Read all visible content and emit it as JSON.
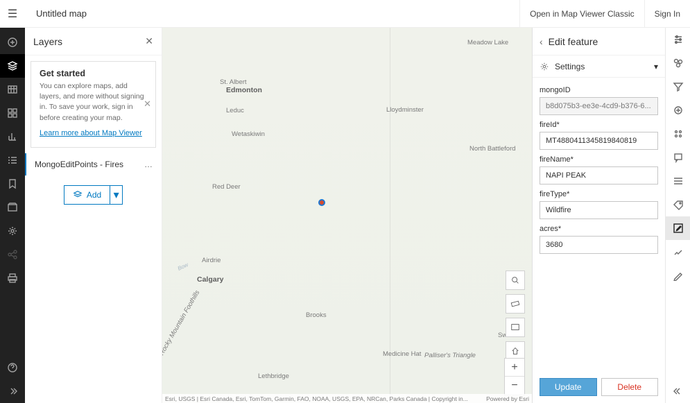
{
  "header": {
    "title": "Untitled map",
    "classic_link": "Open in Map Viewer Classic",
    "sign_in": "Sign In"
  },
  "panel": {
    "title": "Layers",
    "card": {
      "title": "Get started",
      "body": "You can explore maps, add layers, and more without signing in. To save your work, sign in before creating your map.",
      "link": "Learn more about Map Viewer"
    },
    "layer_name": "MongoEditPoints - Fires",
    "add_label": "Add"
  },
  "map": {
    "labels": {
      "meadow_lake": "Meadow Lake",
      "st_albert": "St. Albert",
      "edmonton": "Edmonton",
      "leduc": "Leduc",
      "wetaskiwin": "Wetaskiwin",
      "lloydminster": "Lloydminster",
      "north_battleford": "North Battleford",
      "red_deer": "Red Deer",
      "airdrie": "Airdrie",
      "calgary": "Calgary",
      "brooks": "Brooks",
      "medicine_hat": "Medicine Hat",
      "lethbridge": "Lethbridge",
      "swi": "Swi",
      "palliser": "Palliser's Triangle",
      "foothills": "Rocky Mountain Foothills",
      "bow": "Bow"
    },
    "attrib_left": "Esri, USGS | Esri Canada, Esri, TomTom, Garmin, FAO, NOAA, USGS, EPA, NRCan, Parks Canada | Copyright in...",
    "attrib_right": "Powered by Esri"
  },
  "edit": {
    "title": "Edit feature",
    "settings": "Settings",
    "fields": {
      "mongoID_label": "mongoID",
      "mongoID_value": "b8d075b3-ee3e-4cd9-b376-6...",
      "fireId_label": "fireId*",
      "fireId_value": "MT4880411345819840819",
      "fireName_label": "fireName*",
      "fireName_value": "NAPI PEAK",
      "fireType_label": "fireType*",
      "fireType_value": "Wildfire",
      "acres_label": "acres*",
      "acres_value": "3680"
    },
    "update": "Update",
    "delete": "Delete"
  }
}
